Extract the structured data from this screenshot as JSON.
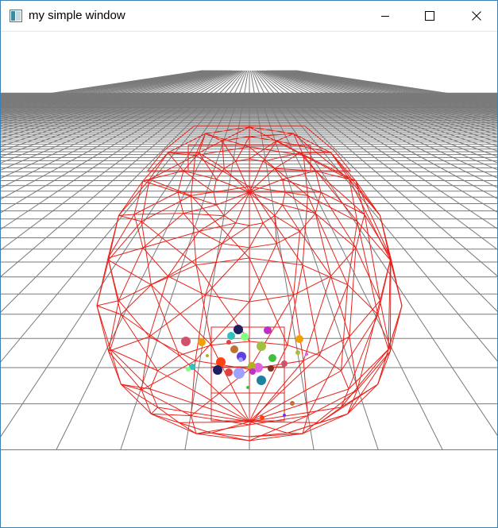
{
  "window": {
    "title": "my simple window",
    "controls": [
      "minimize",
      "maximize",
      "close"
    ]
  },
  "scene": {
    "background_color": "#ffffff",
    "grid_color": "#7a7a7a",
    "mesh_color": "#e8231c",
    "particle_colors": [
      "#d0506e",
      "#f0a000",
      "#202060",
      "#c030c0",
      "#30c0c0",
      "#80ff80",
      "#a0c040",
      "#c07030",
      "#ff4010",
      "#6040e0",
      "#e060e0",
      "#b0b020",
      "#40c040",
      "#a0a0ff",
      "#e04040",
      "#803020",
      "#2080a0"
    ]
  }
}
